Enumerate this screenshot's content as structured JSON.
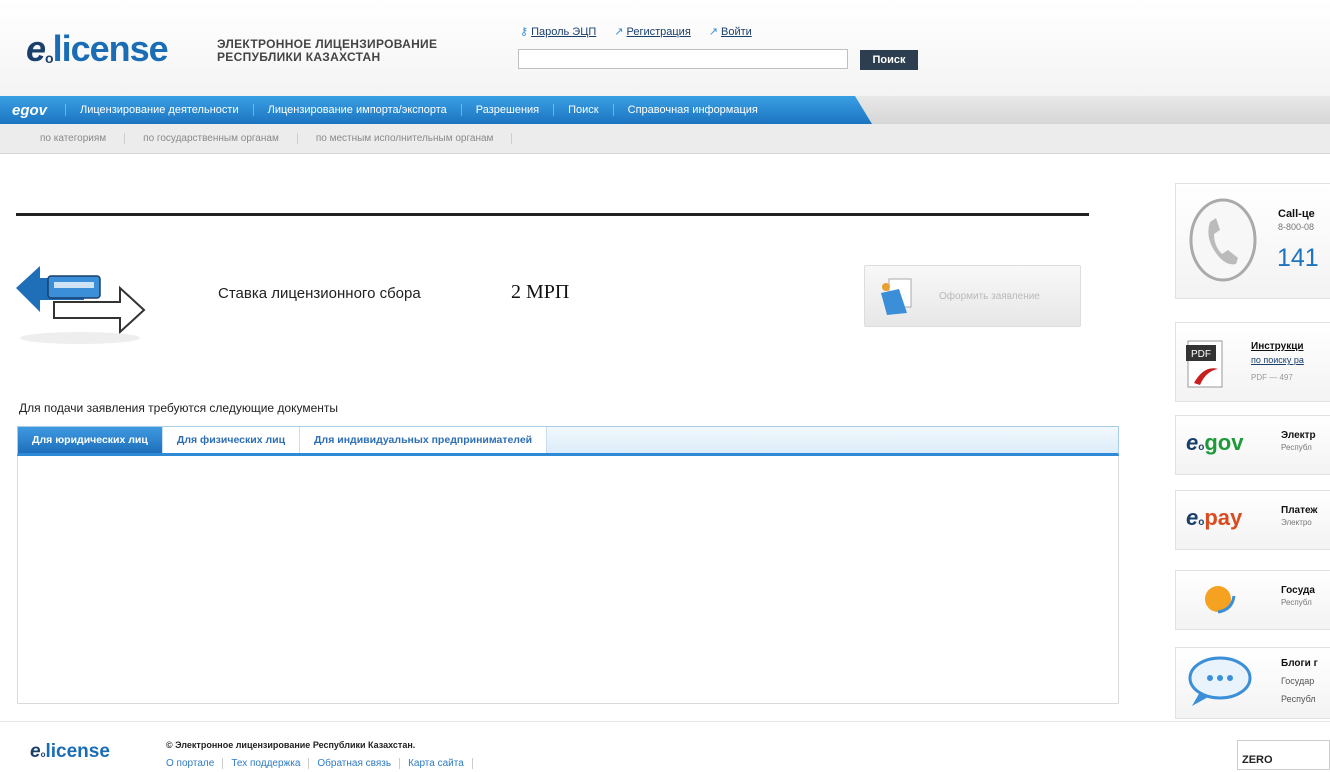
{
  "header": {
    "logo_main": "license",
    "logo_e": "e",
    "logo_sub": "o",
    "tagline_line1": "ЭЛЕКТРОННОЕ ЛИЦЕНЗИРОВАНИЕ",
    "tagline_line2": "РЕСПУБЛИКИ КАЗАХСТАН",
    "toplinks": [
      "Пароль ЭЦП",
      "Регистрация",
      "Войти"
    ],
    "search_placeholder": "",
    "search_button": "Поиск"
  },
  "nav": {
    "egov_label": "egov",
    "items": [
      "Лицензирование деятельности",
      "Лицензирование импорта/экспорта",
      "Разрешения",
      "Поиск",
      "Справочная информация"
    ]
  },
  "subnav": {
    "items": [
      "по категориям",
      "по государственным органам",
      "по местным исполнительным органам"
    ]
  },
  "main": {
    "fee_label": "Ставка лицензионного сбора",
    "fee_value": "2 МРП",
    "apply_label": "Оформить заявление",
    "docs_heading": "Для подачи заявления требуются следующие документы",
    "tabs": [
      "Для юридических лиц",
      "Для физических лиц",
      "Для индивидуальных предпринимателей"
    ],
    "active_tab": 0
  },
  "sidebar": {
    "callcenter_title": "Call-це",
    "callcenter_phone": "8-800-08",
    "callcenter_short": "141",
    "pdf_title": "Инструкци",
    "pdf_sub": "по поиску ра",
    "pdf_meta": "PDF — 497",
    "egov_title": "Электр",
    "egov_sub": "Республ",
    "epay_title": "Платеж",
    "epay_sub": "Электро",
    "gov_title": "Госуда",
    "gov_sub": "Республ",
    "blog_title": "Блоги г",
    "blog_line2": "Государ",
    "blog_line3": "Республ"
  },
  "footer": {
    "copyright": "© Электронное лицензирование Республики Казахстан.",
    "links": [
      "О портале",
      "Тех поддержка",
      "Обратная связь",
      "Карта сайта"
    ],
    "badge": "ZERO"
  },
  "colors": {
    "brand_blue": "#1c74c0",
    "nav_blue": "#3aa0e4",
    "dark_navy": "#1b3f6b"
  }
}
